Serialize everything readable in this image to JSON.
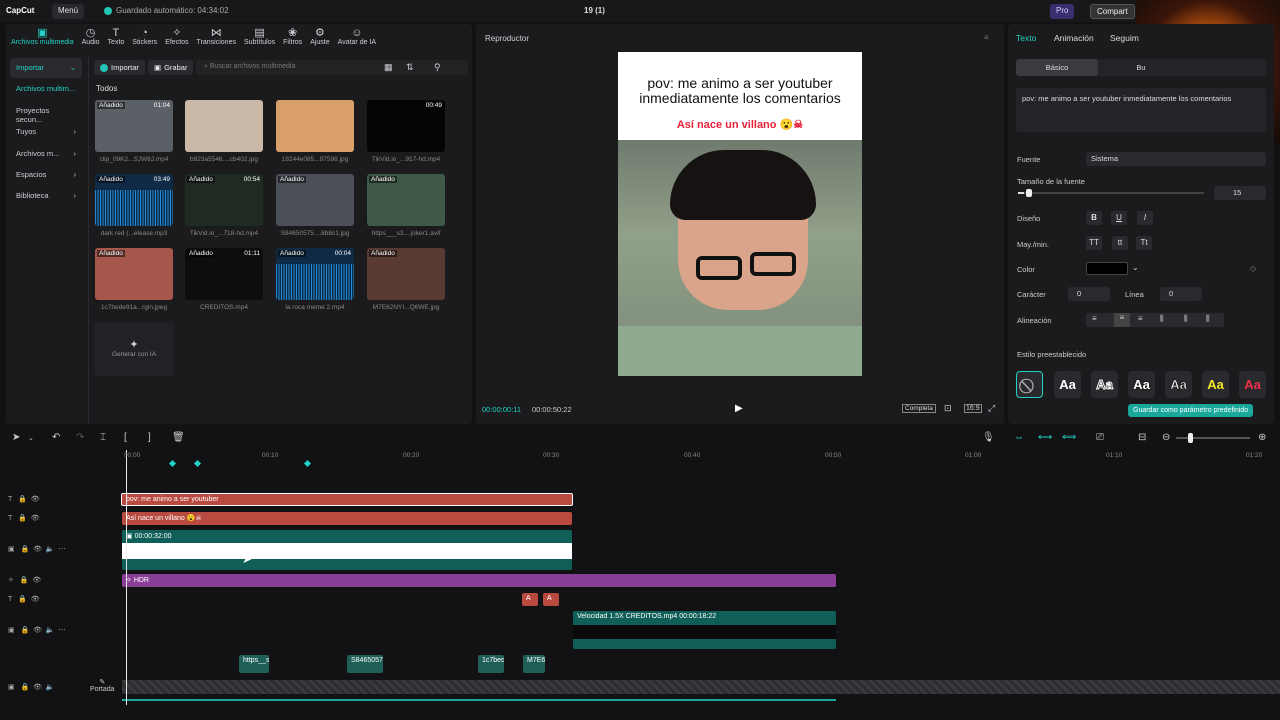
{
  "topbar": {
    "logo": "CapCut",
    "menu": "Menú",
    "autosave": "Guardado automático: 04:34:02",
    "project": "19 (1)",
    "pro": "Pro",
    "share": "Compart"
  },
  "tools": [
    {
      "icon": "media-icon",
      "glyph": "▣",
      "label": "Archivos multimedia"
    },
    {
      "icon": "audio-icon",
      "glyph": "◷",
      "label": "Audio"
    },
    {
      "icon": "text-icon",
      "glyph": "T",
      "label": "Texto"
    },
    {
      "icon": "stickers-icon",
      "glyph": "◔",
      "label": "Stickers"
    },
    {
      "icon": "effects-icon",
      "glyph": "✧",
      "label": "Efectos"
    },
    {
      "icon": "transitions-icon",
      "glyph": "⋈",
      "label": "Transiciones"
    },
    {
      "icon": "subtitles-icon",
      "glyph": "▤",
      "label": "Subtítulos"
    },
    {
      "icon": "filters-icon",
      "glyph": "❀",
      "label": "Filtros"
    },
    {
      "icon": "adjust-icon",
      "glyph": "⚙",
      "label": "Ajuste"
    },
    {
      "icon": "ai-avatar-icon",
      "glyph": "☺",
      "label": "Avatar de IA"
    }
  ],
  "sidenav": [
    {
      "label": "Importar",
      "chev": "⌄"
    },
    {
      "label": "Archivos multim...",
      "chev": ""
    },
    {
      "label": "Proyectos secun...",
      "chev": ""
    },
    {
      "label": "Tuyos",
      "chev": "›"
    },
    {
      "label": "Archivos m...",
      "chev": "›"
    },
    {
      "label": "Espacios",
      "chev": "›"
    },
    {
      "label": "Biblioteca",
      "chev": "›"
    }
  ],
  "media": {
    "import_label": "Importar",
    "record_label": "Grabar",
    "search_placeholder": "Buscar archivos multimedia",
    "all_label": "Todos",
    "generate_ai": "Generar con IA",
    "items": [
      {
        "name": "clip_09K2...SJW8J.mp4",
        "badge": "Añadido",
        "dur": "01:04",
        "color": "#5b5f66"
      },
      {
        "name": "b923a5546....cb402.jpg",
        "badge": "",
        "dur": "",
        "color": "#c9b9a6"
      },
      {
        "name": "18244e085...97598.jpg",
        "badge": "",
        "dur": "",
        "color": "#d9a06a"
      },
      {
        "name": "TikVid.io_...917-hd.mp4",
        "badge": "",
        "dur": "00:49",
        "color": "#050505"
      },
      {
        "name": "dark red (...elease.mp3",
        "badge": "Añadido",
        "dur": "03:49",
        "color": "#0f2a45",
        "audio": true
      },
      {
        "name": "TikVid.io_...718-hd.mp4",
        "badge": "Añadido",
        "dur": "00:54",
        "color": "#1f2a22"
      },
      {
        "name": "S84650575....6b8c1.jpg",
        "badge": "Añadido",
        "dur": "",
        "color": "#4a4f58"
      },
      {
        "name": "https___s3....joker1.avif",
        "badge": "Añadido",
        "dur": "",
        "color": "#3e5a46"
      },
      {
        "name": "1c7bede91a...rgin.jpeg",
        "badge": "Añadido",
        "dur": "",
        "color": "#a4574a"
      },
      {
        "name": "CREDITOS.mp4",
        "badge": "Añadido",
        "dur": "01:11",
        "color": "#0d0d0d"
      },
      {
        "name": "la roca meme 2.mp4",
        "badge": "Añadido",
        "dur": "00:04",
        "color": "#0f2a45",
        "audio": true
      },
      {
        "name": "M7E62NYI...Q6WE.jpg",
        "badge": "Añadido",
        "dur": "",
        "color": "#5a3b34"
      }
    ]
  },
  "player": {
    "title": "Reproductor",
    "caption1": "pov: me animo a ser youtuber inmediatamente los comentarios",
    "caption2": "Así nace un villano 😮☠",
    "time_current": "00:00:00:11",
    "time_total": "00:00:50:22",
    "fit": "Completa"
  },
  "props": {
    "tabs": [
      "Texto",
      "Animación",
      "Seguim"
    ],
    "subtabs": [
      "Básico",
      "Bu"
    ],
    "text": "pov: me animo a ser youtuber inmediatamente los comentarios",
    "font_label": "Fuente",
    "font_value": "Sistema",
    "size_label": "Tamaño de la fuente",
    "size_value": "15",
    "size_level": 0.03,
    "design_label": "Diseño",
    "case_label": "May./min.",
    "color_label": "Color",
    "color_value": "#000000",
    "char_label": "Carácter",
    "char_value": "0",
    "line_label": "Línea",
    "line_value": "0",
    "align_label": "Alineación",
    "preset_label": "Estilo preestablecido",
    "save_default": "Guardar como parámetro predefinido"
  },
  "timeline": {
    "ticks": [
      "00:00",
      "00:10",
      "00:20",
      "00:30",
      "00:40",
      "00:50",
      "01:00",
      "01:10",
      "01:20"
    ],
    "clips": {
      "text1": "pov: me animo a ser youtuber",
      "text2": "Así nace un villano 😮☠",
      "video_main": "00:00:32:00",
      "hdr": "HDR",
      "credits": "Velocidad 1.5X  CREDITOS.mp4  00:00:18:22",
      "small1": "https__s",
      "small2": "S8465057",
      "small3": "1c7bedi",
      "small4": "M7E6"
    },
    "cover_label": "Portada"
  }
}
